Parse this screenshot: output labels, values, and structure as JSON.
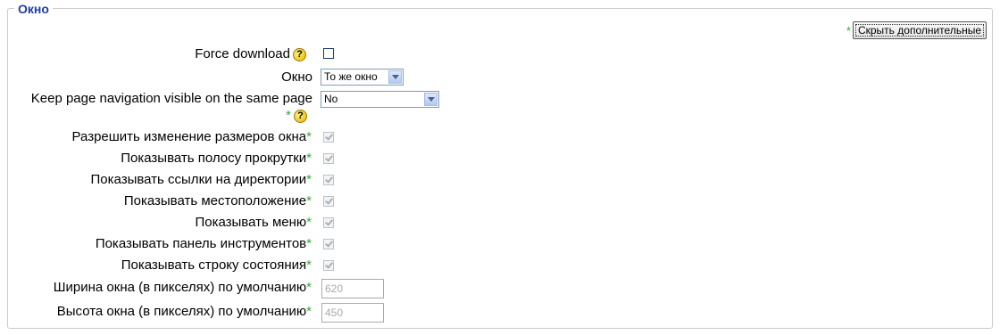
{
  "legend": "Окно",
  "show_advanced": {
    "star": "*",
    "label": "Скрыть дополнительные"
  },
  "required_marker": "*",
  "help_icon_text": "?",
  "force_download": {
    "label": "Force download",
    "checked": false
  },
  "window": {
    "label": "Окно",
    "selected": "То же окно"
  },
  "keep_nav": {
    "label": "Keep page navigation visible on the same page",
    "selected": "No"
  },
  "checkbox_options": [
    {
      "label": "Разрешить изменение размеров окна",
      "checked": true
    },
    {
      "label": "Показывать полосу прокрутки",
      "checked": true
    },
    {
      "label": "Показывать ссылки на директории",
      "checked": true
    },
    {
      "label": "Показывать местоположение",
      "checked": true
    },
    {
      "label": "Показывать меню",
      "checked": true
    },
    {
      "label": "Показывать панель инструментов",
      "checked": true
    },
    {
      "label": "Показывать строку состояния",
      "checked": true
    }
  ],
  "width_field": {
    "label": "Ширина окна (в пикселях) по умолчанию",
    "value": "620"
  },
  "height_field": {
    "label": "Высота окна (в пикселях) по умолчанию",
    "value": "450"
  }
}
